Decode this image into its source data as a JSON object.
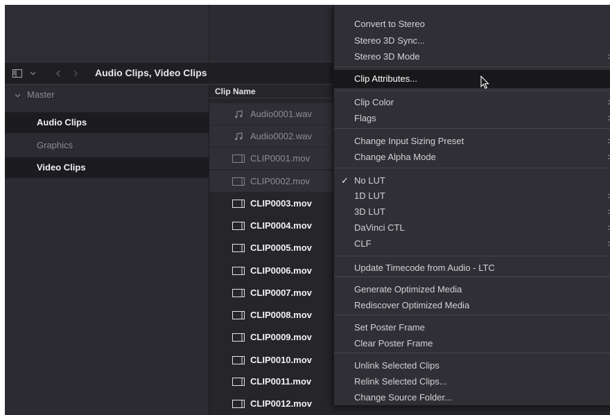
{
  "toolbar": {
    "breadcrumb": "Audio Clips, Video Clips",
    "icons": [
      "sidebar-toggle-icon",
      "chevron-down-icon",
      "back-arrow-icon",
      "forward-arrow-icon"
    ]
  },
  "sidebar": {
    "master": "Master",
    "items": [
      {
        "label": "Audio Clips",
        "selected": true
      },
      {
        "label": "Graphics",
        "selected": false
      },
      {
        "label": "Video Clips",
        "selected": true
      }
    ]
  },
  "cliplist": {
    "header": "Clip Name",
    "clips": [
      {
        "name": "Audio0001.wav",
        "type": "audio",
        "dimmed": true
      },
      {
        "name": "Audio0002.wav",
        "type": "audio",
        "dimmed": true
      },
      {
        "name": "CLIP0001.mov",
        "type": "video",
        "dimmed": true
      },
      {
        "name": "CLIP0002.mov",
        "type": "video",
        "dimmed": true
      },
      {
        "name": "CLIP0003.mov",
        "type": "video",
        "dimmed": false
      },
      {
        "name": "CLIP0004.mov",
        "type": "video",
        "dimmed": false
      },
      {
        "name": "CLIP0005.mov",
        "type": "video",
        "dimmed": false
      },
      {
        "name": "CLIP0006.mov",
        "type": "video",
        "dimmed": false
      },
      {
        "name": "CLIP0007.mov",
        "type": "video",
        "dimmed": false
      },
      {
        "name": "CLIP0008.mov",
        "type": "video",
        "dimmed": false
      },
      {
        "name": "CLIP0009.mov",
        "type": "video",
        "dimmed": false
      },
      {
        "name": "CLIP0010.mov",
        "type": "video",
        "dimmed": false
      },
      {
        "name": "CLIP0011.mov",
        "type": "video",
        "dimmed": false
      },
      {
        "name": "CLIP0012.mov",
        "type": "video",
        "dimmed": false
      }
    ]
  },
  "menu": {
    "items": [
      {
        "label": "Convert to Stereo",
        "submenu": false
      },
      {
        "label": "Stereo 3D Sync...",
        "submenu": false
      },
      {
        "label": "Stereo 3D Mode",
        "submenu": true
      },
      {
        "label": "Clip Attributes...",
        "submenu": false,
        "highlighted": true
      },
      {
        "label": "Clip Color",
        "submenu": true
      },
      {
        "label": "Flags",
        "submenu": true
      },
      {
        "label": "Change Input Sizing Preset",
        "submenu": true
      },
      {
        "label": "Change Alpha Mode",
        "submenu": true
      },
      {
        "label": "No LUT",
        "submenu": false,
        "checked": true
      },
      {
        "label": "1D LUT",
        "submenu": true
      },
      {
        "label": "3D LUT",
        "submenu": true
      },
      {
        "label": "DaVinci CTL",
        "submenu": true
      },
      {
        "label": "CLF",
        "submenu": true
      },
      {
        "label": "Update Timecode from Audio - LTC",
        "submenu": false
      },
      {
        "label": "Generate Optimized Media",
        "submenu": false
      },
      {
        "label": "Rediscover Optimized Media",
        "submenu": false
      },
      {
        "label": "Set Poster Frame",
        "submenu": false
      },
      {
        "label": "Clear Poster Frame",
        "submenu": false
      },
      {
        "label": "Unlink Selected Clips",
        "submenu": false
      },
      {
        "label": "Relink Selected Clips...",
        "submenu": false
      },
      {
        "label": "Change Source Folder...",
        "submenu": false
      }
    ],
    "check_glyph": "✓",
    "arrow_glyph": ">"
  },
  "colors": {
    "panel": "#28282e",
    "menu": "#2f2f35",
    "highlight": "#18181b",
    "text": "#d3d3d7"
  }
}
